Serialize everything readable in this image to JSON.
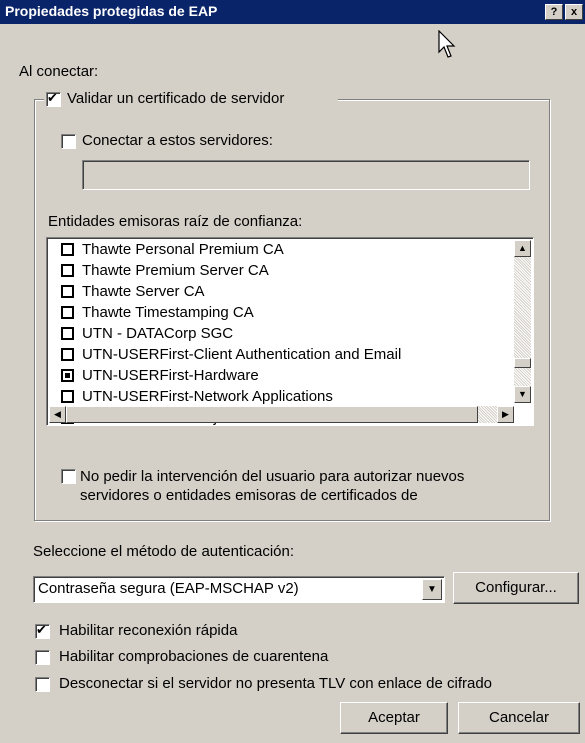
{
  "window": {
    "title": "Propiedades protegidas de EAP",
    "help_btn": "?",
    "close_btn": "x"
  },
  "on_connect": {
    "label": "Al conectar:",
    "validate_cert": {
      "label": "Validar un certificado de servidor",
      "checked": true
    },
    "connect_servers": {
      "label": "Conectar a estos servidores:",
      "checked": false,
      "value": ""
    },
    "root_ca_label": "Entidades emisoras raíz de confianza:",
    "root_ca_list": [
      {
        "label": "Thawte Personal Premium CA",
        "checked": false
      },
      {
        "label": "Thawte Premium Server CA",
        "checked": false
      },
      {
        "label": "Thawte Server CA",
        "checked": false
      },
      {
        "label": "Thawte Timestamping CA",
        "checked": false
      },
      {
        "label": "UTN - DATACorp SGC",
        "checked": false
      },
      {
        "label": "UTN-USERFirst-Client Authentication and Email",
        "checked": false
      },
      {
        "label": "UTN-USERFirst-Hardware",
        "checked": true
      },
      {
        "label": "UTN-USERFirst-Network Applications",
        "checked": false
      },
      {
        "label": "UTN-USERFirst-Object",
        "checked": false
      }
    ],
    "no_prompt": {
      "label_line1": "No pedir la intervención del usuario para autorizar nuevos",
      "label_line2": "servidores o entidades emisoras de certificados de",
      "checked": false
    }
  },
  "auth": {
    "label": "Seleccione el método de autenticación:",
    "selected": "Contraseña segura (EAP-MSCHAP v2)",
    "configure_btn": "Configurar..."
  },
  "options": {
    "fast_reconnect": {
      "label": "Habilitar reconexión rápida",
      "checked": true
    },
    "quarantine": {
      "label": "Habilitar comprobaciones de cuarentena",
      "checked": false
    },
    "disconnect_tlv": {
      "label": "Desconectar si el servidor no presenta TLV con enlace de cifrado",
      "checked": false
    }
  },
  "buttons": {
    "ok": "Aceptar",
    "cancel": "Cancelar"
  },
  "colors": {
    "titlebar": "#0a246a",
    "face": "#d4d0c8"
  }
}
